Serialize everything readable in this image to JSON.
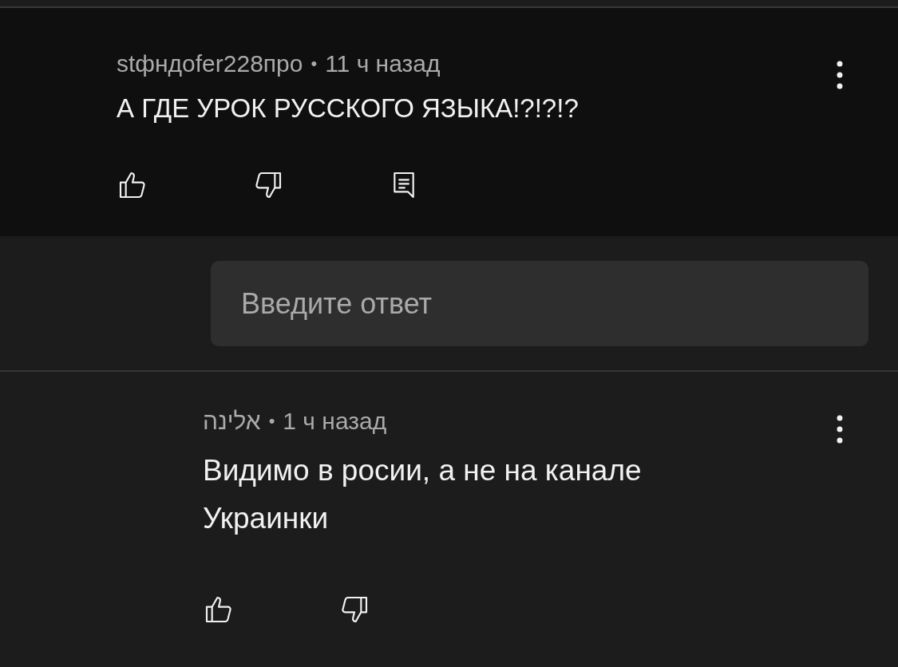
{
  "comments": [
    {
      "author": "stфндofer228про",
      "separator": "•",
      "time": "11 ч назад",
      "body": "А ГДЕ УРОК РУССКОГО ЯЗЫКА!?!?!?",
      "kind": "top",
      "actions": [
        {
          "kind": "like"
        },
        {
          "kind": "dislike"
        },
        {
          "kind": "reply"
        }
      ]
    },
    {
      "author": "אלינה",
      "separator": "•",
      "time": "1 ч назад",
      "body": "Видимо в росии, а не на канале Украинки",
      "kind": "reply",
      "actions": [
        {
          "kind": "like"
        },
        {
          "kind": "dislike"
        }
      ]
    }
  ],
  "reply_field": {
    "placeholder": "Введите ответ"
  }
}
